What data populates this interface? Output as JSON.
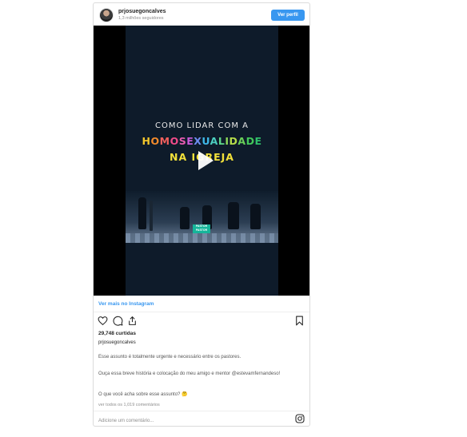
{
  "header": {
    "username": "prjosuegoncalves",
    "followers": "1,3 milhões seguidores",
    "follow_label": "Ver perfil"
  },
  "video": {
    "line1": "COMO  LIDAR COM A",
    "line2_letters": [
      {
        "ch": "H",
        "color": "#f2c62b"
      },
      {
        "ch": "O",
        "color": "#f28a2b"
      },
      {
        "ch": "M",
        "color": "#f25f5c"
      },
      {
        "ch": "O",
        "color": "#f24b8a"
      },
      {
        "ch": "S",
        "color": "#e85bb0"
      },
      {
        "ch": "E",
        "color": "#c85bd8"
      },
      {
        "ch": "X",
        "color": "#6d8cf0"
      },
      {
        "ch": "U",
        "color": "#3fb8e8"
      },
      {
        "ch": "A",
        "color": "#4ccfc0"
      },
      {
        "ch": "L",
        "color": "#5fd88a"
      },
      {
        "ch": "I",
        "color": "#8fdc5a"
      },
      {
        "ch": "D",
        "color": "#b6dc4a"
      },
      {
        "ch": "A",
        "color": "#6bd05a"
      },
      {
        "ch": "D",
        "color": "#43c85a"
      },
      {
        "ch": "E",
        "color": "#2fbf6a"
      }
    ],
    "line3": "NA  IGREJA",
    "badge_text": "PASTOR"
  },
  "see_more": "Ver mais no Instagram",
  "likes": "29,748 curtidas",
  "post_user": "prjosuegoncalves",
  "caption": {
    "p1": "Esse assunto é totalmente urgente e necessário entre os pastores.",
    "p2": "Ouça essa breve história e colocação do meu amigo e mentor @estevamfernandeso!",
    "p3": "O que você acha sobre esse assunto? 🤔"
  },
  "comments_link": "ver todos os 1,019 comentários",
  "add_comment_placeholder": "Adicione um comentário...",
  "colors": {
    "accent": "#3897f0",
    "border": "#dbdbdb"
  },
  "icons": [
    "heart-icon",
    "comment-icon",
    "share-icon",
    "bookmark-icon",
    "instagram-icon",
    "play-icon"
  ]
}
